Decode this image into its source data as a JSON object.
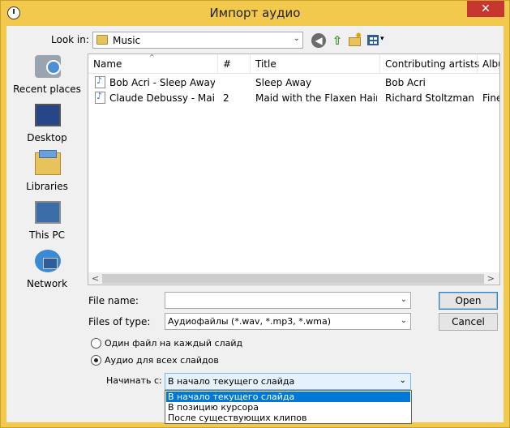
{
  "window": {
    "title": "Импорт аудио",
    "close_glyph": "✕"
  },
  "lookin": {
    "label": "Look in:",
    "value": "Music",
    "arrow": "⌄"
  },
  "toolbar": {
    "back_glyph": "◀",
    "up_glyph": "⇧",
    "newfolder_glyph": "✸",
    "view_glyph": "▾"
  },
  "places": [
    {
      "label": "Recent places",
      "icon": "recent-places-icon"
    },
    {
      "label": "Desktop",
      "icon": "desktop-icon"
    },
    {
      "label": "Libraries",
      "icon": "libraries-icon"
    },
    {
      "label": "This PC",
      "icon": "this-pc-icon"
    },
    {
      "label": "Network",
      "icon": "network-icon"
    }
  ],
  "filelist": {
    "columns": [
      "Name",
      "#",
      "Title",
      "Contributing artists",
      "Albu"
    ],
    "sort_glyph": "^",
    "rows": [
      {
        "name": "Bob Acri - Sleep Away",
        "num": "",
        "title": "Sleep Away",
        "artist": "Bob Acri",
        "album": ""
      },
      {
        "name": "Claude Debussy - Mai...",
        "num": "2",
        "title": "Maid with the Flaxen Hair",
        "artist": "Richard Stoltzman...",
        "album": "Fine"
      }
    ],
    "scroll_left": "<",
    "scroll_right": ">"
  },
  "filename": {
    "label": "File name:",
    "value": "",
    "arrow": "⌄"
  },
  "filetype": {
    "label": "Files of type:",
    "value": "Аудиофайлы (*.wav, *.mp3, *.wma)",
    "arrow": "⌄"
  },
  "buttons": {
    "open": "Open",
    "cancel": "Cancel"
  },
  "options": {
    "one_per_slide": "Один файл на каждый слайд",
    "all_slides": "Аудио для всех слайдов",
    "selected": "all_slides"
  },
  "start": {
    "label": "Начинать с:",
    "value": "В начало текущего слайда",
    "arrow": "⌄",
    "options": [
      "В начало текущего слайда",
      "В позицию курсора",
      "После существующих клипов"
    ]
  }
}
